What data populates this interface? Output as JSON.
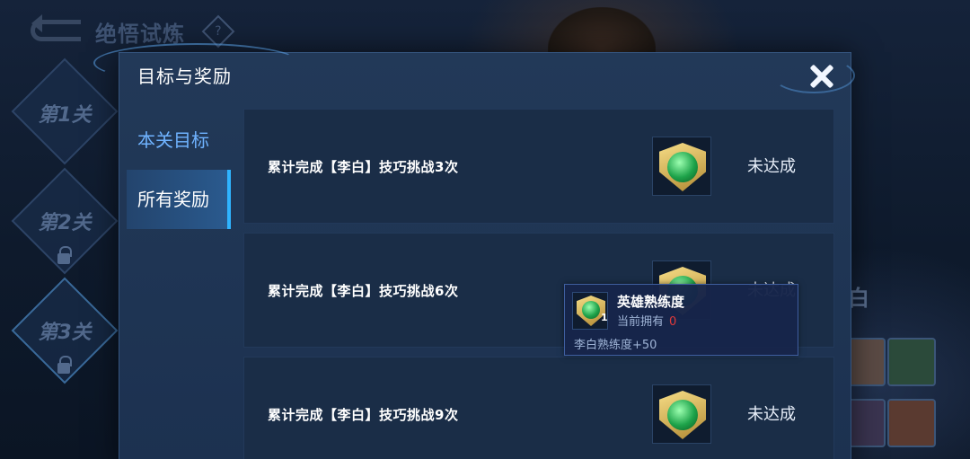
{
  "background": {
    "page_title": "绝悟试炼",
    "help_icon": "question-icon",
    "help_glyph": "?",
    "levels": [
      "第1关",
      "第2关",
      "第3关"
    ],
    "hero_name_partial": "白"
  },
  "dialog": {
    "title": "目标与奖励",
    "close_icon": "close-icon",
    "tabs": [
      {
        "label": "本关目标",
        "active": false
      },
      {
        "label": "所有奖励",
        "active": true
      }
    ],
    "goals": [
      {
        "text": "累计完成【李白】技巧挑战3次",
        "status": "未达成"
      },
      {
        "text": "累计完成【李白】技巧挑战6次",
        "status": "未达成"
      },
      {
        "text": "累计完成【李白】技巧挑战9次",
        "status": "未达成"
      }
    ]
  },
  "tooltip": {
    "title": "英雄熟练度",
    "owned_label": "当前拥有",
    "owned_value": "0",
    "count": "1",
    "description": "李白熟练度+50"
  },
  "colors": {
    "accent": "#2fb4ff",
    "active_tab_text": "#6fb3ff",
    "owned_value": "#e23a3a"
  }
}
